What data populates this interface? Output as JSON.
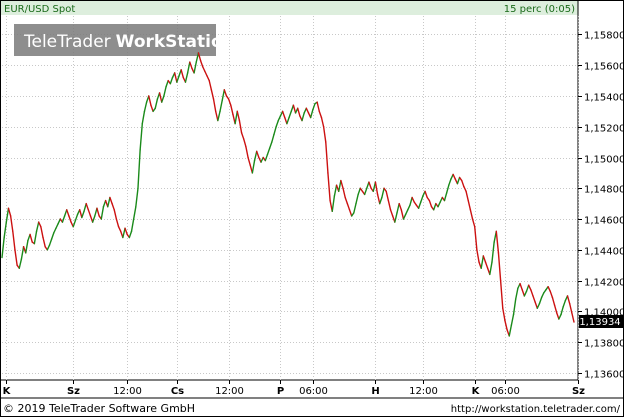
{
  "header": {
    "instrument": "EUR/USD Spot",
    "interval": "15 perc (0:05)"
  },
  "watermark": {
    "text_light": "TeleTrader",
    "text_bold": "WorkStation"
  },
  "footer": {
    "copyright": "© 2019 TeleTrader Software GmbH",
    "url": "http://workstation.teletrader.com/"
  },
  "colors": {
    "up": "#1a8a1a",
    "down": "#cc1111",
    "grid": "#c8c8c8",
    "header_bg": "#ddeedd",
    "last_price_bg": "#000000",
    "last_price_fg": "#ffffff",
    "watermark_bg": "#7a7a7a",
    "watermark_fg": "#ffffff"
  },
  "chart_data": {
    "type": "line",
    "title": "EUR/USD Spot",
    "subtitle": "15 perc (0:05)",
    "y_axis_position": "right",
    "ylim": [
      1.1356,
      1.1592
    ],
    "grid": true,
    "y_ticks": [
      "1,13600",
      "1,13800",
      "1,14000",
      "1,14200",
      "1,14400",
      "1,14600",
      "1,14800",
      "1,15000",
      "1,15200",
      "1,15400",
      "1,15600",
      "1,15800"
    ],
    "y_tick_values": [
      1.136,
      1.138,
      1.14,
      1.142,
      1.144,
      1.146,
      1.148,
      1.15,
      1.152,
      1.154,
      1.156,
      1.158
    ],
    "x_ticks": [
      {
        "label": "K",
        "bold": true,
        "index": 2
      },
      {
        "label": "Sz",
        "bold": true,
        "index": 33
      },
      {
        "label": "12:00",
        "bold": false,
        "index": 58
      },
      {
        "label": "Cs",
        "bold": true,
        "index": 81
      },
      {
        "label": "12:00",
        "bold": false,
        "index": 105
      },
      {
        "label": "P",
        "bold": true,
        "index": 129
      },
      {
        "label": "06:00",
        "bold": false,
        "index": 144
      },
      {
        "label": "H",
        "bold": true,
        "index": 173
      },
      {
        "label": "12:00",
        "bold": false,
        "index": 195
      },
      {
        "label": "K",
        "bold": true,
        "index": 219
      },
      {
        "label": "06:00",
        "bold": false,
        "index": 233
      },
      {
        "label": "Sz",
        "bold": true,
        "index": 267
      }
    ],
    "last_price": "1,13934",
    "last_price_value": 1.13934,
    "series": [
      {
        "values": [
          1.1435,
          1.1448,
          1.1458,
          1.1467,
          1.1462,
          1.1452,
          1.144,
          1.143,
          1.1428,
          1.1434,
          1.1442,
          1.1438,
          1.1446,
          1.145,
          1.1445,
          1.1444,
          1.1452,
          1.1458,
          1.1455,
          1.1448,
          1.1442,
          1.144,
          1.1443,
          1.1447,
          1.1451,
          1.1454,
          1.1457,
          1.146,
          1.1458,
          1.1462,
          1.1466,
          1.1462,
          1.1458,
          1.1455,
          1.1459,
          1.1463,
          1.1466,
          1.1461,
          1.1465,
          1.147,
          1.1466,
          1.1462,
          1.1458,
          1.1462,
          1.1467,
          1.1462,
          1.146,
          1.1468,
          1.1472,
          1.1468,
          1.1474,
          1.147,
          1.1466,
          1.146,
          1.1455,
          1.1452,
          1.1448,
          1.1454,
          1.145,
          1.1448,
          1.1452,
          1.146,
          1.1468,
          1.148,
          1.1505,
          1.1522,
          1.153,
          1.1536,
          1.154,
          1.1534,
          1.153,
          1.1532,
          1.1538,
          1.1542,
          1.1536,
          1.154,
          1.1546,
          1.155,
          1.1548,
          1.1552,
          1.1555,
          1.1549,
          1.1553,
          1.1557,
          1.1552,
          1.1549,
          1.1555,
          1.1562,
          1.1558,
          1.1555,
          1.1562,
          1.1568,
          1.1563,
          1.1559,
          1.1556,
          1.1553,
          1.155,
          1.1544,
          1.1538,
          1.153,
          1.1524,
          1.153,
          1.1537,
          1.1544,
          1.154,
          1.1538,
          1.1534,
          1.1528,
          1.1522,
          1.153,
          1.1524,
          1.1516,
          1.1512,
          1.1507,
          1.15,
          1.1495,
          1.149,
          1.1498,
          1.1504,
          1.15,
          1.1497,
          1.15,
          1.1498,
          1.1502,
          1.1506,
          1.151,
          1.1515,
          1.152,
          1.1524,
          1.1527,
          1.153,
          1.1526,
          1.1522,
          1.1526,
          1.153,
          1.1534,
          1.1529,
          1.1532,
          1.1527,
          1.1524,
          1.1529,
          1.1532,
          1.1529,
          1.1526,
          1.1531,
          1.1535,
          1.1536,
          1.153,
          1.1526,
          1.152,
          1.151,
          1.149,
          1.1472,
          1.1465,
          1.1475,
          1.1482,
          1.1478,
          1.1485,
          1.148,
          1.1474,
          1.147,
          1.1466,
          1.1462,
          1.1464,
          1.147,
          1.1476,
          1.148,
          1.1478,
          1.1476,
          1.148,
          1.1484,
          1.148,
          1.1478,
          1.1484,
          1.1476,
          1.147,
          1.1474,
          1.148,
          1.1478,
          1.1472,
          1.1466,
          1.1462,
          1.1458,
          1.1464,
          1.147,
          1.1466,
          1.146,
          1.1463,
          1.1466,
          1.1469,
          1.1474,
          1.1471,
          1.1469,
          1.1467,
          1.1471,
          1.1475,
          1.1478,
          1.1474,
          1.1472,
          1.1468,
          1.1466,
          1.147,
          1.1468,
          1.1471,
          1.1474,
          1.1472,
          1.1477,
          1.1482,
          1.1486,
          1.1489,
          1.1486,
          1.1483,
          1.1487,
          1.1485,
          1.1481,
          1.1478,
          1.1472,
          1.1466,
          1.146,
          1.1455,
          1.144,
          1.1432,
          1.1428,
          1.1436,
          1.1432,
          1.1428,
          1.1424,
          1.1432,
          1.1445,
          1.1452,
          1.1438,
          1.142,
          1.1402,
          1.1394,
          1.1388,
          1.1384,
          1.1391,
          1.1398,
          1.1408,
          1.1415,
          1.1418,
          1.1414,
          1.141,
          1.1413,
          1.1417,
          1.1414,
          1.141,
          1.1406,
          1.1402,
          1.1405,
          1.1409,
          1.1412,
          1.1414,
          1.1416,
          1.1413,
          1.1409,
          1.1404,
          1.1399,
          1.1395,
          1.1398,
          1.1403,
          1.1407,
          1.141,
          1.1405,
          1.1399,
          1.1393
        ]
      }
    ]
  }
}
